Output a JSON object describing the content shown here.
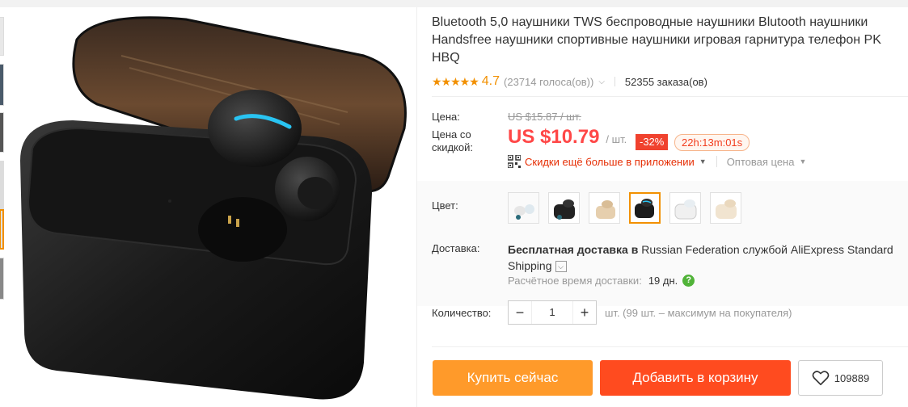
{
  "product": {
    "title": "Bluetooth 5,0 наушники TWS беспроводные наушники Blutooth наушники Handsfree наушники спортивные наушники игровая гарнитура телефон PK HBQ"
  },
  "rating": {
    "stars": "★★★★★",
    "value": "4.7",
    "votes": "(23714 голоса(ов))",
    "orders": "52355 заказа(ов)"
  },
  "price": {
    "label": "Цена:",
    "original": "US $15.87 / шт.",
    "discount_label_line1": "Цена со",
    "discount_label_line2": "скидкой:",
    "current": "US $10.79",
    "unit": "/ шт.",
    "discount_pct": "-32%",
    "countdown": "22h:13m:01s",
    "app_promo": "Скидки ещё больше в приложении",
    "wholesale": "Оптовая цена"
  },
  "color": {
    "label": "Цвет:",
    "selected_index": 3
  },
  "shipping": {
    "label": "Доставка:",
    "bold_part": "Бесплатная доставка в",
    "rest_part": " Russian Federation службой AliExpress Standard Shipping",
    "eta_label": "Расчётное время доставки:",
    "eta_value": "19 дн."
  },
  "quantity": {
    "label": "Количество:",
    "minus": "−",
    "value": "1",
    "plus": "+",
    "note": "шт. (99 шт. – максимум на покупателя)"
  },
  "actions": {
    "buy_now": "Купить сейчас",
    "add_to_cart": "Добавить в корзину",
    "wishlist_count": "109889"
  },
  "colors": {
    "accent": "#f29000",
    "price_red": "#ff4747",
    "buy_btn": "#ff9a2a",
    "cart_btn": "#ff4b1f"
  }
}
